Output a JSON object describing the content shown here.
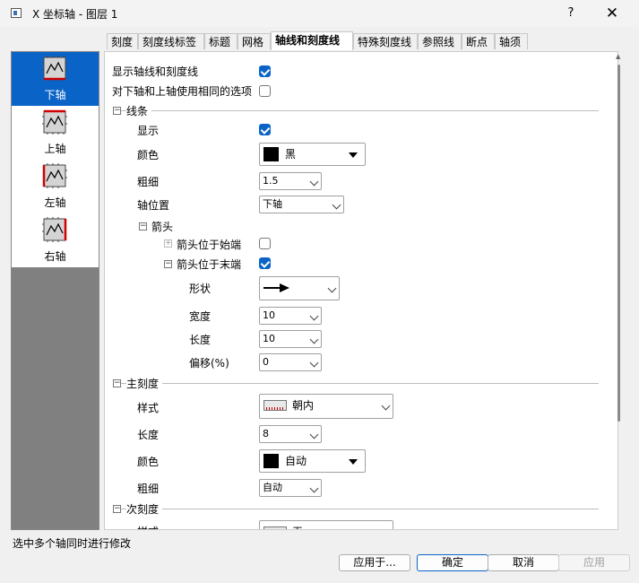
{
  "window": {
    "title": "X 坐标轴 - 图层 1",
    "help": "?",
    "close": "✕"
  },
  "tabs": [
    {
      "label": "刻度"
    },
    {
      "label": "刻度线标签"
    },
    {
      "label": "标题"
    },
    {
      "label": "网格"
    },
    {
      "label": "轴线和刻度线",
      "active": true
    },
    {
      "label": "特殊刻度线"
    },
    {
      "label": "参照线"
    },
    {
      "label": "断点"
    },
    {
      "label": "轴须"
    }
  ],
  "axes": [
    {
      "label": "下轴",
      "selected": true,
      "icon": "bottom-axis-icon"
    },
    {
      "label": "上轴",
      "icon": "top-axis-icon"
    },
    {
      "label": "左轴",
      "icon": "left-axis-icon"
    },
    {
      "label": "右轴",
      "icon": "right-axis-icon"
    }
  ],
  "options": {
    "show_axes_ticks": {
      "label": "显示轴线和刻度线",
      "checked": true
    },
    "same_options": {
      "label": "对下轴和上轴使用相同的选项",
      "checked": false
    }
  },
  "line": {
    "header": "线条",
    "show_label": "显示",
    "show_checked": true,
    "color_label": "颜色",
    "color_value": "黑",
    "thickness_label": "粗细",
    "thickness_value": "1.5",
    "position_label": "轴位置",
    "position_value": "下轴"
  },
  "arrow": {
    "header": "箭头",
    "start_label": "箭头位于始端",
    "start_checked": false,
    "end_label": "箭头位于末端",
    "end_checked": true,
    "shape_label": "形状",
    "width_label": "宽度",
    "width_value": "10",
    "length_label": "长度",
    "length_value": "10",
    "offset_label": "偏移(%)",
    "offset_value": "0"
  },
  "major": {
    "header": "主刻度",
    "style_label": "样式",
    "style_value": "朝内",
    "length_label": "长度",
    "length_value": "8",
    "color_label": "颜色",
    "color_value": "自动",
    "thickness_label": "粗细",
    "thickness_value": "自动"
  },
  "minor": {
    "header": "次刻度",
    "style_label": "样式",
    "style_value": "无"
  },
  "colors": {
    "accent": "#0a64c8",
    "swatch": "#000000",
    "axis_red": "#d00000"
  },
  "status": {
    "text": "选中多个轴同时进行修改"
  },
  "buttons": {
    "apply_to": "应用于...",
    "ok": "确定",
    "cancel": "取消",
    "apply": "应用"
  }
}
